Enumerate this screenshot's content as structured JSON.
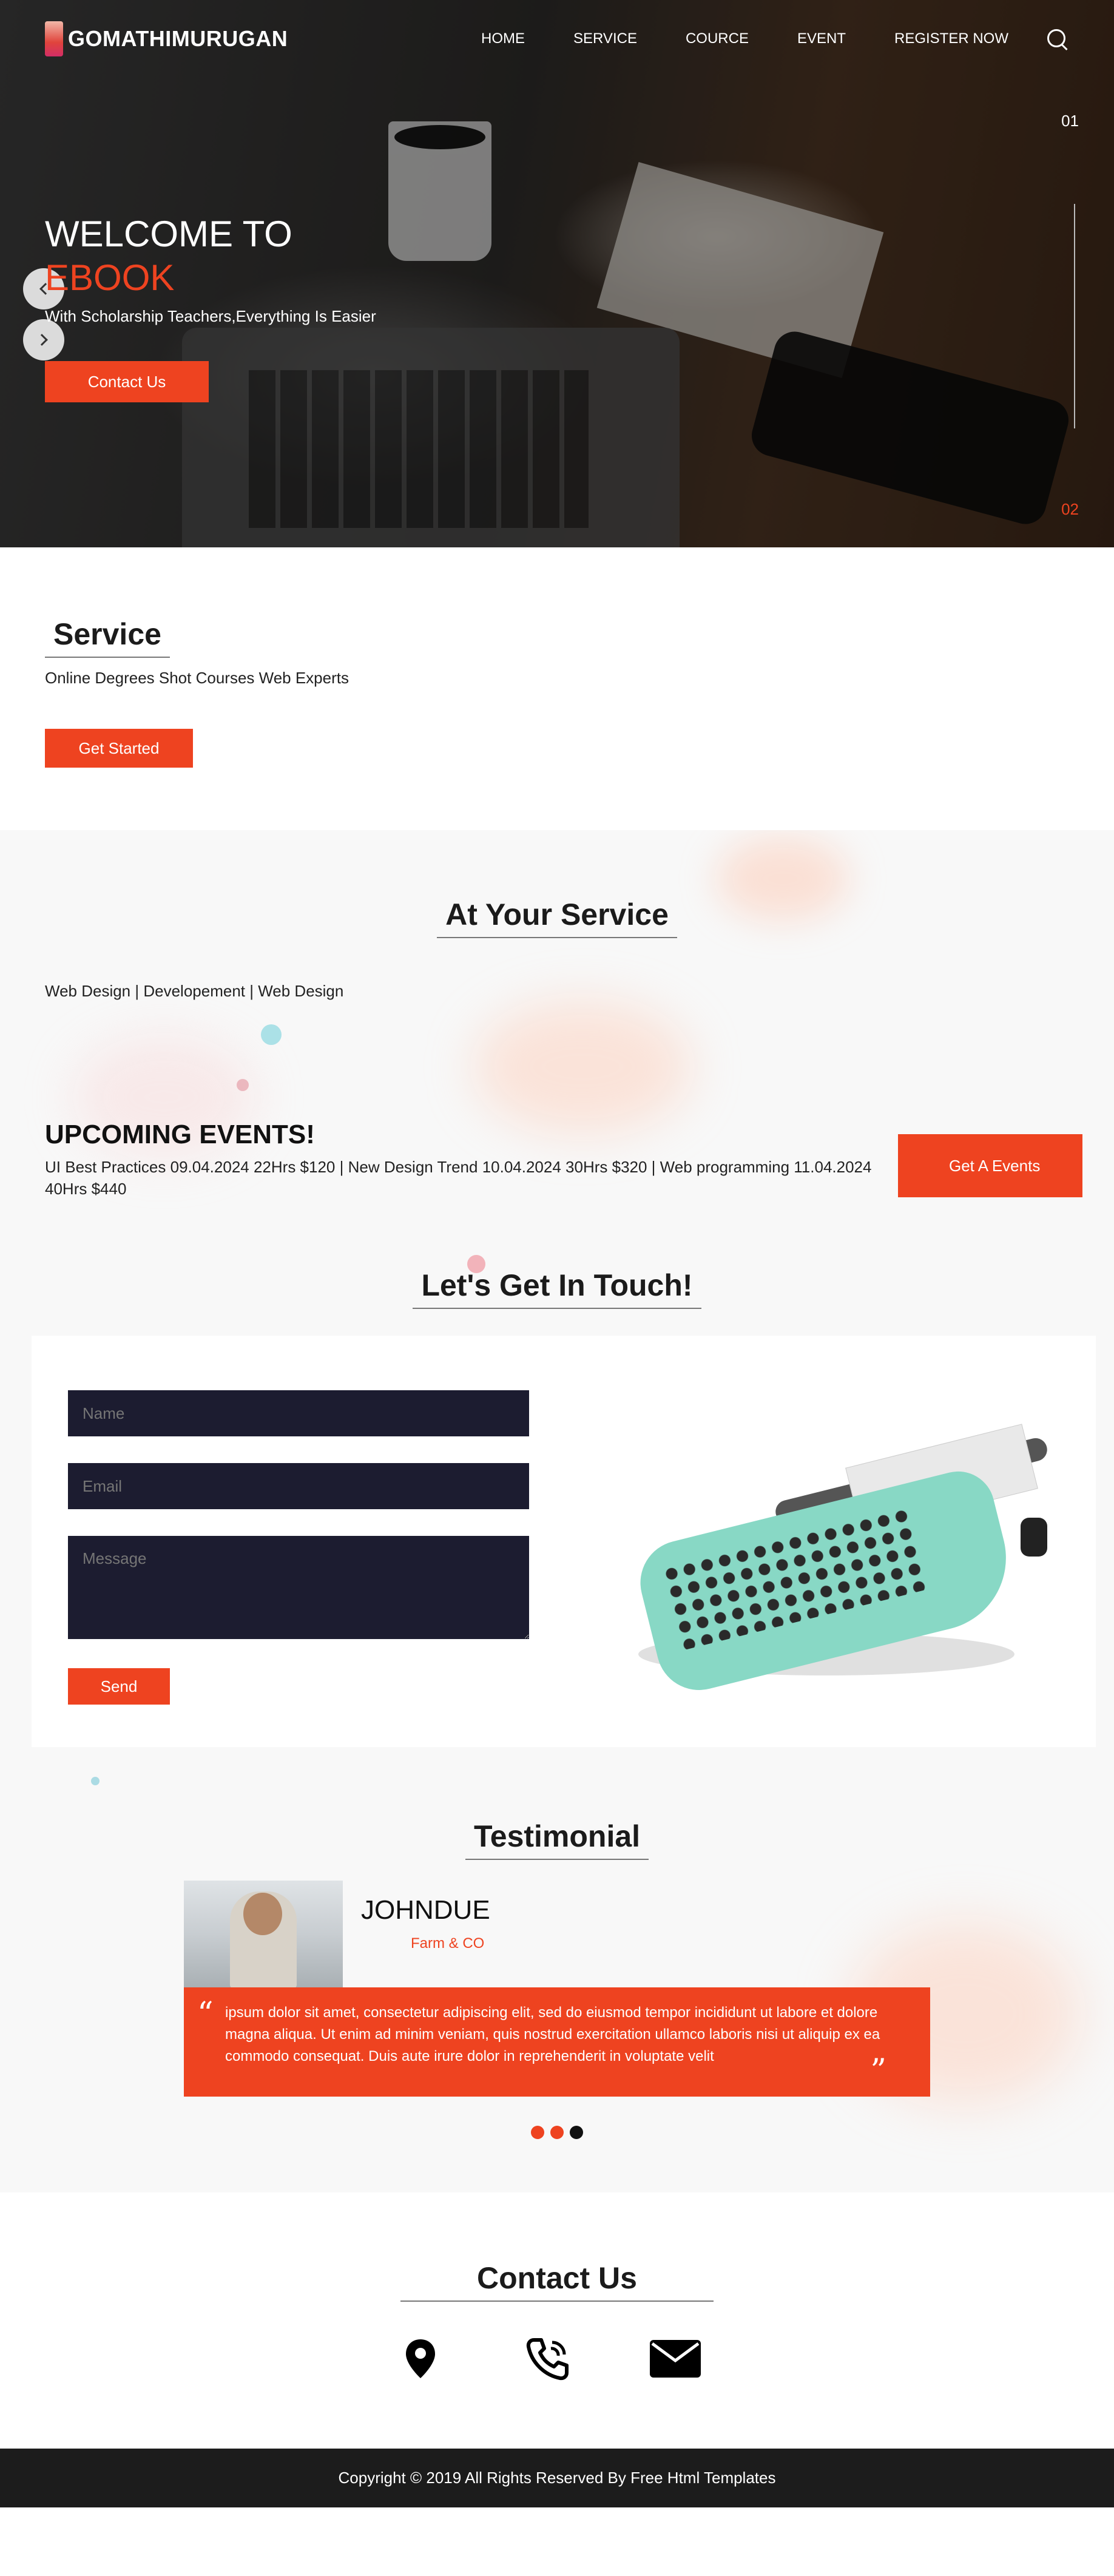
{
  "brand": {
    "name": "GOMATHIMURUGAN"
  },
  "nav": {
    "items": [
      "HOME",
      "SERVICE",
      "COURCE",
      "EVENT",
      "REGISTER NOW"
    ],
    "search_icon": "search-icon"
  },
  "hero": {
    "title": "WELCOME TO",
    "title_accent": "EBOOK",
    "subtitle": "With Scholarship Teachers,Everything Is Easier",
    "button": "Contact Us",
    "slide_top": "01",
    "slide_bottom": "02"
  },
  "service": {
    "heading": "Service",
    "text": "Online Degrees Shot Courses Web Experts",
    "button": "Get Started"
  },
  "at_service": {
    "heading": "At Your Service",
    "list": "Web Design | Developement | Web Design"
  },
  "events": {
    "title": "UPCOMING EVENTS!",
    "text": "UI Best Practices 09.04.2024 22Hrs $120 | New Design Trend 10.04.2024 30Hrs $320 | Web programming 11.04.2024 40Hrs $440",
    "button": "Get A Events"
  },
  "touch": {
    "heading": "Let's Get In Touch!",
    "name_placeholder": "Name",
    "email_placeholder": "Email",
    "message_placeholder": "Message",
    "send": "Send"
  },
  "testimonial": {
    "heading": "Testimonial",
    "name": "JOHNDUE",
    "company": "Farm & CO",
    "quote": "ipsum dolor sit amet, consectetur adipiscing elit, sed do eiusmod tempor incididunt ut labore et dolore magna aliqua. Ut enim ad minim veniam, quis nostrud exercitation ullamco laboris nisi ut aliquip ex ea commodo consequat. Duis aute irure dolor in reprehenderit in voluptate velit",
    "dots_count": 3,
    "active_dot": 3
  },
  "contact": {
    "heading": "Contact Us",
    "icons": [
      "location-pin-icon",
      "phone-icon",
      "mail-icon"
    ]
  },
  "footer": {
    "copyright": "Copyright © 2019 All Rights Reserved By Free Html Templates"
  },
  "colors": {
    "accent": "#ee4320",
    "dark_field": "#1c1c30",
    "footer_bg": "#1c1c1c"
  }
}
